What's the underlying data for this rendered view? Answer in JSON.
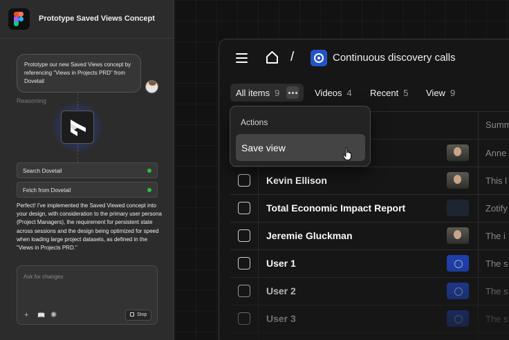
{
  "sidebar": {
    "title": "Prototype Saved Views Concept",
    "prompt": "Prototype our new Saved Views concept by referencing \"Views in Projects PRD\" from Dovetail",
    "reasoning_label": "Reasoning",
    "tools": [
      {
        "label": "Search Dovetail",
        "status": "success"
      },
      {
        "label": "Fetch from Dovetail",
        "status": "success"
      }
    ],
    "summary": "Perfect! I've implemented the Saved Viewed concept into your design, with consideration to the primary user persona (Project Managers), the requirement for persistent state across sessions and the design being optimized for speed when loading large project datasets, as defined in the \"Views in Projects PRD.\"",
    "input": {
      "placeholder": "Ask for changes",
      "stop_label": "Stop"
    },
    "icons": [
      "figma-logo-icon",
      "dovetail-logo-icon",
      "plus-icon",
      "book-icon",
      "sparkle-icon"
    ],
    "status_color": "#28c23c"
  },
  "app": {
    "breadcrumb_separator": "/",
    "project_title": "Continuous discovery calls",
    "project_icon_color": "#2253c8",
    "tabs": [
      {
        "label": "All items",
        "count": "9",
        "active": true
      },
      {
        "label": "Videos",
        "count": "4"
      },
      {
        "label": "Recent",
        "count": "5"
      },
      {
        "label": "View",
        "count": "9"
      }
    ],
    "table": {
      "summary_header": "Summ",
      "rows": [
        {
          "name": "",
          "thumb": "person",
          "summary": "Anne"
        },
        {
          "name": "Kevin Ellison",
          "thumb": "person",
          "summary": "This l"
        },
        {
          "name": "Total Economic Impact Report",
          "thumb": "dark",
          "summary": "Zotify"
        },
        {
          "name": "Jeremie Gluckman",
          "thumb": "person",
          "summary": "The i"
        },
        {
          "name": "User 1",
          "thumb": "blue",
          "summary": "The s"
        },
        {
          "name": "User 2",
          "thumb": "blue",
          "summary": "The s"
        },
        {
          "name": "User 3",
          "thumb": "blue",
          "summary": "The s"
        }
      ]
    },
    "menu": {
      "title": "Actions",
      "items": [
        "Save view"
      ]
    }
  }
}
